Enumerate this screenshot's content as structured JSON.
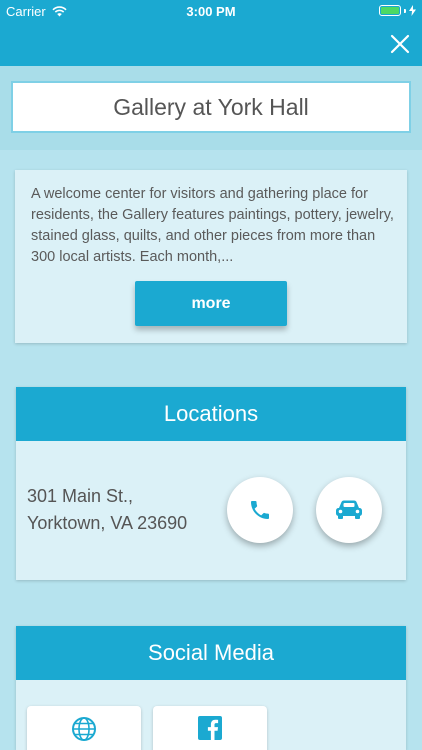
{
  "status_bar": {
    "carrier": "Carrier",
    "time": "3:00 PM"
  },
  "nav": {
    "close_icon": "close-icon"
  },
  "title": "Gallery at York Hall",
  "description": {
    "text": "A welcome center for visitors and gathering place for residents, the Gallery features paintings, pottery, jewelry, stained glass, quilts, and other pieces from more than 300 local artists. Each month,...",
    "more_label": "more"
  },
  "locations": {
    "header": "Locations",
    "address_line1": "301 Main St.,",
    "address_line2": "Yorktown, VA 23690",
    "call_icon": "phone-icon",
    "directions_icon": "car-icon"
  },
  "social": {
    "header": "Social Media",
    "items": [
      {
        "icon": "globe-icon"
      },
      {
        "icon": "facebook-icon"
      }
    ]
  },
  "colors": {
    "accent": "#1ba9d1",
    "card": "#dbf1f7",
    "background": "#b6e3ee",
    "battery": "#4cd964"
  }
}
